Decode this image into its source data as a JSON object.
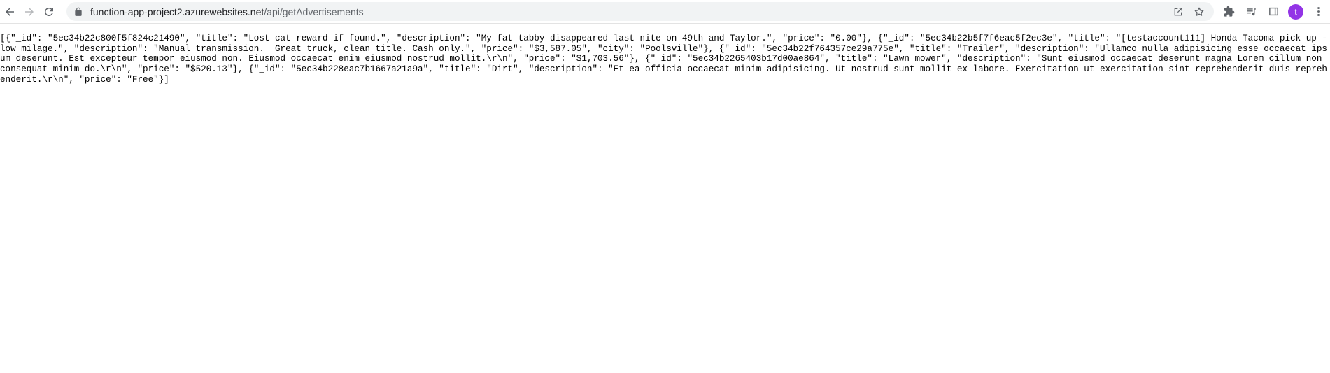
{
  "browser": {
    "url_host": "function-app-project2.azurewebsites.net",
    "url_path": "/api/getAdvertisements",
    "avatar_letter": "t",
    "avatar_color": "#9334e6"
  },
  "response": {
    "json_text": "[{\"_id\": \"5ec34b22c800f5f824c21490\", \"title\": \"Lost cat reward if found.\", \"description\": \"My fat tabby disappeared last nite on 49th and Taylor.\", \"price\": \"0.00\"}, {\"_id\": \"5ec34b22b5f7f6eac5f2ec3e\", \"title\": \"[testaccount111] Honda Tacoma pick up - low milage.\", \"description\": \"Manual transmission.  Great truck, clean title. Cash only.\", \"price\": \"$3,587.05\", \"city\": \"Poolsville\"}, {\"_id\": \"5ec34b22f764357ce29a775e\", \"title\": \"Trailer\", \"description\": \"Ullamco nulla adipisicing esse occaecat ipsum deserunt. Est excepteur tempor eiusmod non. Eiusmod occaecat enim eiusmod nostrud mollit.\\r\\n\", \"price\": \"$1,703.56\"}, {\"_id\": \"5ec34b2265403b17d00ae864\", \"title\": \"Lawn mower\", \"description\": \"Sunt eiusmod occaecat deserunt magna Lorem cillum non consequat minim do.\\r\\n\", \"price\": \"$520.13\"}, {\"_id\": \"5ec34b228eac7b1667a21a9a\", \"title\": \"Dirt\", \"description\": \"Et ea officia occaecat minim adipisicing. Ut nostrud sunt mollit ex labore. Exercitation ut exercitation sint reprehenderit duis reprehenderit.\\r\\n\", \"price\": \"Free\"}]"
  },
  "icons": [
    "back-icon",
    "forward-icon",
    "reload-icon",
    "lock-icon",
    "share-icon",
    "bookmark-star-icon",
    "extensions-icon",
    "media-queue-icon",
    "side-panel-icon",
    "profile-avatar",
    "kebab-menu-icon"
  ]
}
